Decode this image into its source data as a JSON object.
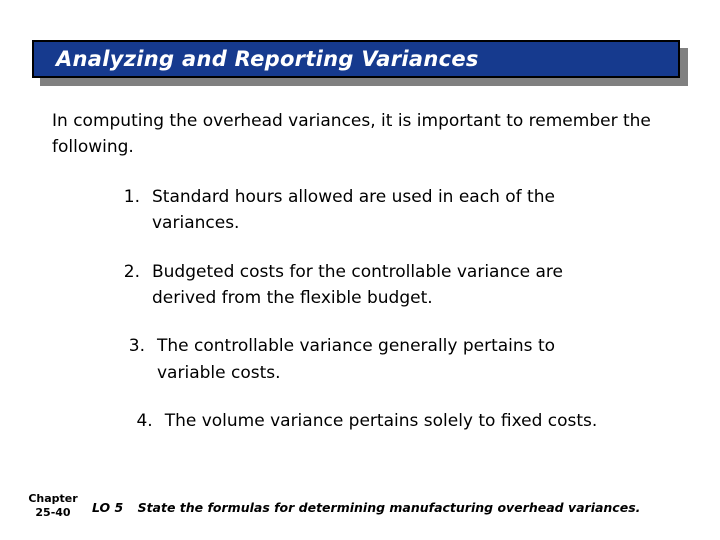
{
  "slide": {
    "title": "Analyzing and Reporting Variances",
    "intro": "In computing the overhead variances, it is important to remember the following.",
    "points": [
      {
        "number": "1.",
        "text": "Standard hours allowed are used in each of the variances."
      },
      {
        "number": "2.",
        "text": "Budgeted costs for the controllable variance are derived from the flexible budget."
      },
      {
        "number": "3.",
        "text": "The controllable variance generally pertains to variable costs."
      },
      {
        "number": "4.",
        "text": "The volume variance pertains solely to fixed costs."
      }
    ]
  },
  "footer": {
    "chapter_label": "Chapter",
    "chapter_number": "25-40",
    "lo_tag": "LO 5",
    "lo_text": "State the formulas for determining manufacturing overhead variances."
  },
  "colors": {
    "title_bar": "#163A8E",
    "title_border": "#000000",
    "title_shadow": "#808080",
    "title_text": "#FFFFFF",
    "body_text": "#000000",
    "background": "#FFFFFF"
  }
}
